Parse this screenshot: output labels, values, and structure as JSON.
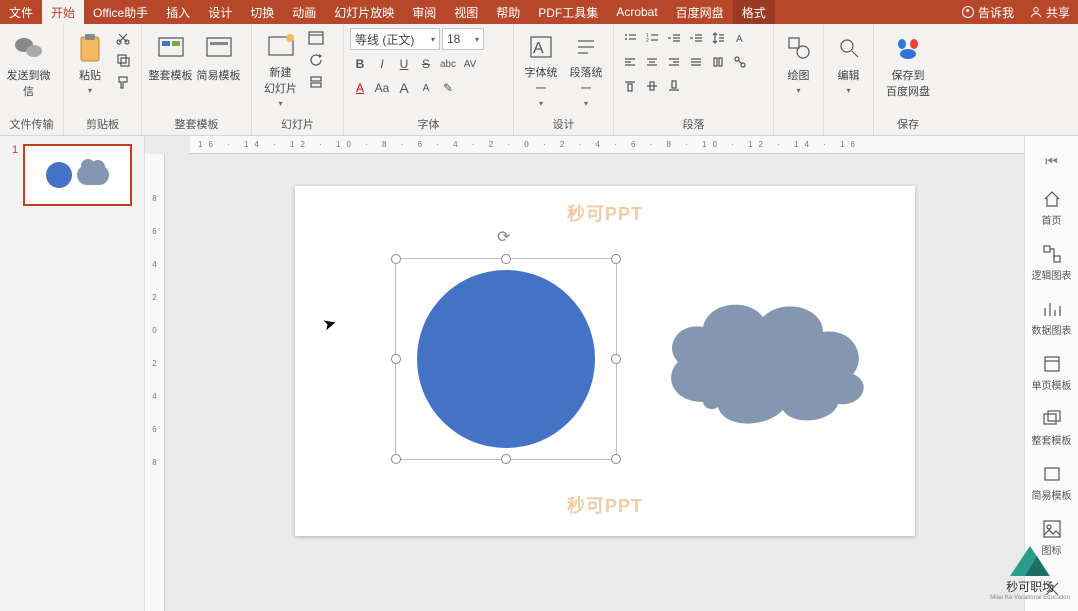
{
  "tabs": {
    "file": "文件",
    "home": "开始",
    "officeHelper": "Office助手",
    "insert": "插入",
    "design": "设计",
    "transition": "切换",
    "animation": "动画",
    "slideshow": "幻灯片放映",
    "review": "审阅",
    "view": "视图",
    "help": "帮助",
    "pdf": "PDF工具集",
    "acrobat": "Acrobat",
    "baidu": "百度网盘",
    "format": "格式",
    "tellme": "告诉我",
    "share": "共享"
  },
  "groups": {
    "sendWeChat": "发送到微信",
    "fileTransfer": "文件传输",
    "paste": "粘贴",
    "clipboard": "剪贴板",
    "wholeTpl": "整套模板",
    "simpleTpl": "简易模板",
    "tplSet": "整套模板",
    "newSlide": "新建\n幻灯片",
    "slides": "幻灯片",
    "fontGroup": "字体",
    "fontUnify": "字体统一",
    "paraUnify": "段落统一",
    "design": "设计",
    "paragraph": "段落",
    "draw": "绘图",
    "edit": "编辑",
    "saveBaidu": "保存到\n百度网盘",
    "save": "保存"
  },
  "font": {
    "name": "等线 (正文)",
    "size": "18"
  },
  "fontButtons": {
    "bold": "B",
    "italic": "I",
    "underline": "U",
    "strike": "S",
    "shadow": "abc",
    "aV": "AV",
    "Acolor": "A",
    "Aa": "Aa",
    "big": "A",
    "small": "A",
    "brush": "✎"
  },
  "ruler": {
    "h": "16 · 14 · 12 · 10 · 8 · 6 · 4 · 2 · 0 · 2 · 4 · 6 · 8 · 10 · 12 · 14 · 16",
    "v": [
      "8",
      "6",
      "4",
      "2",
      "0",
      "2",
      "4",
      "6",
      "8"
    ]
  },
  "slide": {
    "number": "1",
    "watermark": "秒可PPT"
  },
  "sidepanel": {
    "collapse": "",
    "home": "首页",
    "logic": "逻辑图表",
    "data": "数据图表",
    "single": "单页模板",
    "whole": "整套模板",
    "simple": "简易模板",
    "icons": "图标",
    "tools": ""
  },
  "brand": {
    "name": "秒可职场",
    "sub": "Miao Ke Vocational Education"
  }
}
